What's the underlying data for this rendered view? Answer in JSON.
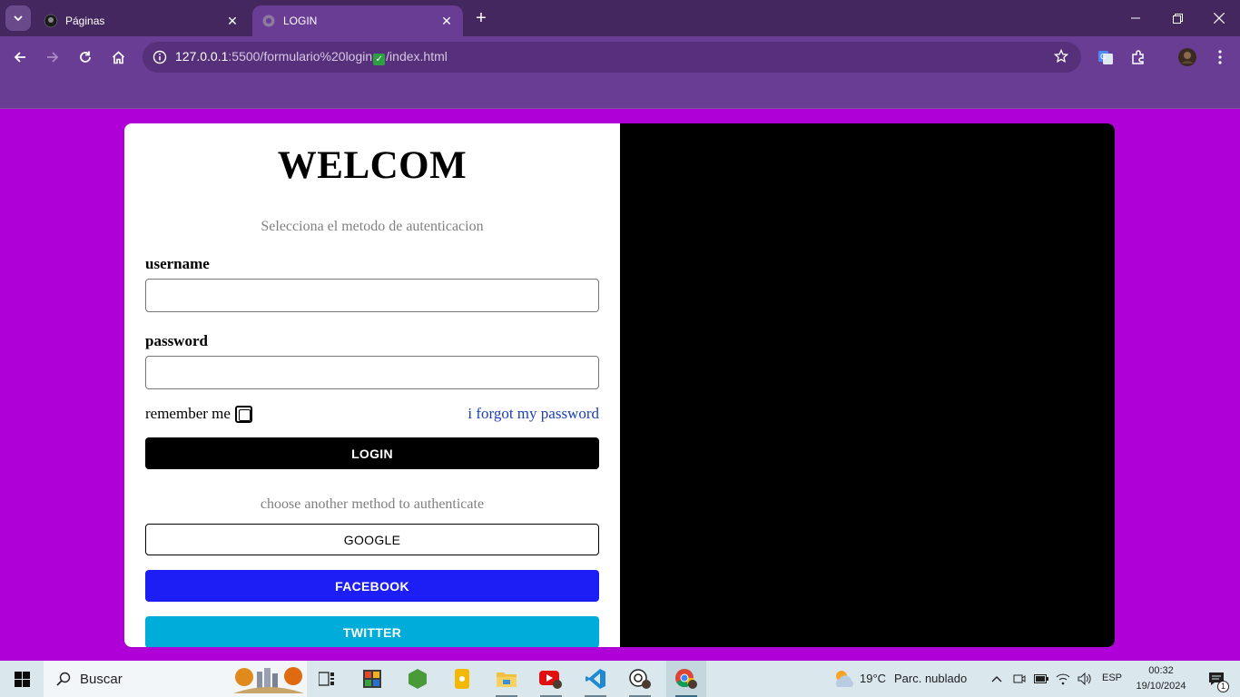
{
  "browser": {
    "tabs": [
      {
        "label": "Páginas",
        "icon": "github-icon",
        "active": false
      },
      {
        "label": "LOGIN",
        "icon": "globe-icon",
        "active": true
      }
    ],
    "url_host": "127.0.0.1",
    "url_path_before": ":5500/formulario%20login",
    "url_check": "✓",
    "url_path_after": "/index.html",
    "accent": "#6a3d95"
  },
  "login": {
    "title": "WELCOM",
    "subtitle": "Selecciona el metodo de autenticacion",
    "username_label": "username",
    "password_label": "password",
    "remember_label": "remember me",
    "forgot_label": "i forgot my password",
    "login_button": "LOGIN",
    "alt_text": "choose another method to authenticate",
    "google_button": "GOOGLE",
    "facebook_button": "FACEBOOK",
    "twitter_button": "TWITTER"
  },
  "colors": {
    "page_bg": "#b000d8",
    "facebook": "#1d1df5",
    "twitter": "#00acd9"
  },
  "taskbar": {
    "search_label": "Buscar",
    "weather_temp": "19°C",
    "weather_text": "Parc. nublado",
    "language": "ESP",
    "time": "00:32",
    "date": "19/10/2024",
    "notifications": "1"
  }
}
